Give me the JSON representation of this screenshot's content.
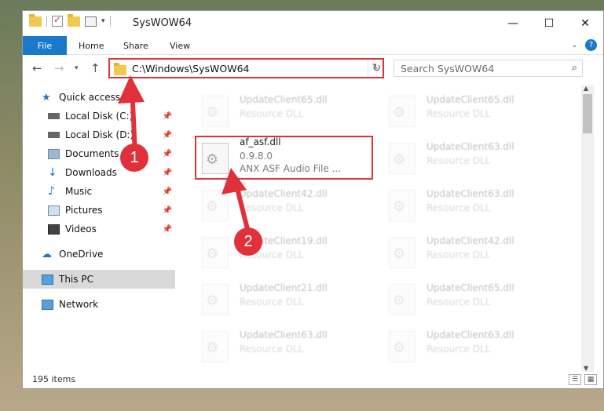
{
  "window": {
    "title": "SysWOW64",
    "controls": [
      "—",
      "☐",
      "✕"
    ]
  },
  "ribbon": {
    "tabs": [
      "File",
      "Home",
      "Share",
      "View"
    ]
  },
  "nav": {
    "address": "C:\\Windows\\SysWOW64",
    "search_placeholder": "Search SysWOW64"
  },
  "sidebar": {
    "items": [
      {
        "label": "Quick access",
        "icon": "star-icon"
      },
      {
        "label": "Local Disk (C:)",
        "icon": "drive-icon"
      },
      {
        "label": "Local Disk (D:)",
        "icon": "drive-icon"
      },
      {
        "label": "Documents",
        "icon": "documents-icon"
      },
      {
        "label": "Downloads",
        "icon": "downloads-icon"
      },
      {
        "label": "Music",
        "icon": "music-icon"
      },
      {
        "label": "Pictures",
        "icon": "pictures-icon"
      },
      {
        "label": "Videos",
        "icon": "videos-icon"
      },
      {
        "label": "OneDrive",
        "icon": "cloud-icon"
      },
      {
        "label": "This PC",
        "icon": "computer-icon"
      },
      {
        "label": "Network",
        "icon": "network-icon"
      }
    ]
  },
  "files": [
    {
      "name": "UpdateClient65.dll",
      "sub": "Resource DLL",
      "extra": ""
    },
    {
      "name": "UpdateClient65.dll",
      "sub": "Resource DLL",
      "extra": ""
    },
    {
      "name": "af_asf.dll",
      "sub": "0.9.8.0",
      "extra": "ANX ASF Audio File ..."
    },
    {
      "name": "UpdateClient63.dll",
      "sub": "Resource DLL",
      "extra": ""
    },
    {
      "name": "UpdateClient42.dll",
      "sub": "Resource DLL",
      "extra": ""
    },
    {
      "name": "UpdateClient63.dll",
      "sub": "Resource DLL",
      "extra": ""
    },
    {
      "name": "UpdateClient19.dll",
      "sub": "Resource DLL",
      "extra": ""
    },
    {
      "name": "UpdateClient42.dll",
      "sub": "Resource DLL",
      "extra": ""
    },
    {
      "name": "UpdateClient21.dll",
      "sub": "Resource DLL",
      "extra": ""
    },
    {
      "name": "UpdateClient65.dll",
      "sub": "Resource DLL",
      "extra": ""
    },
    {
      "name": "UpdateClient63.dll",
      "sub": "Resource DLL",
      "extra": ""
    },
    {
      "name": "UpdateClient63.dll",
      "sub": "Resource DLL",
      "extra": ""
    }
  ],
  "status": {
    "count": "195 items"
  },
  "annotations": {
    "step1": "1",
    "step2": "2",
    "color": "#e0313a"
  }
}
